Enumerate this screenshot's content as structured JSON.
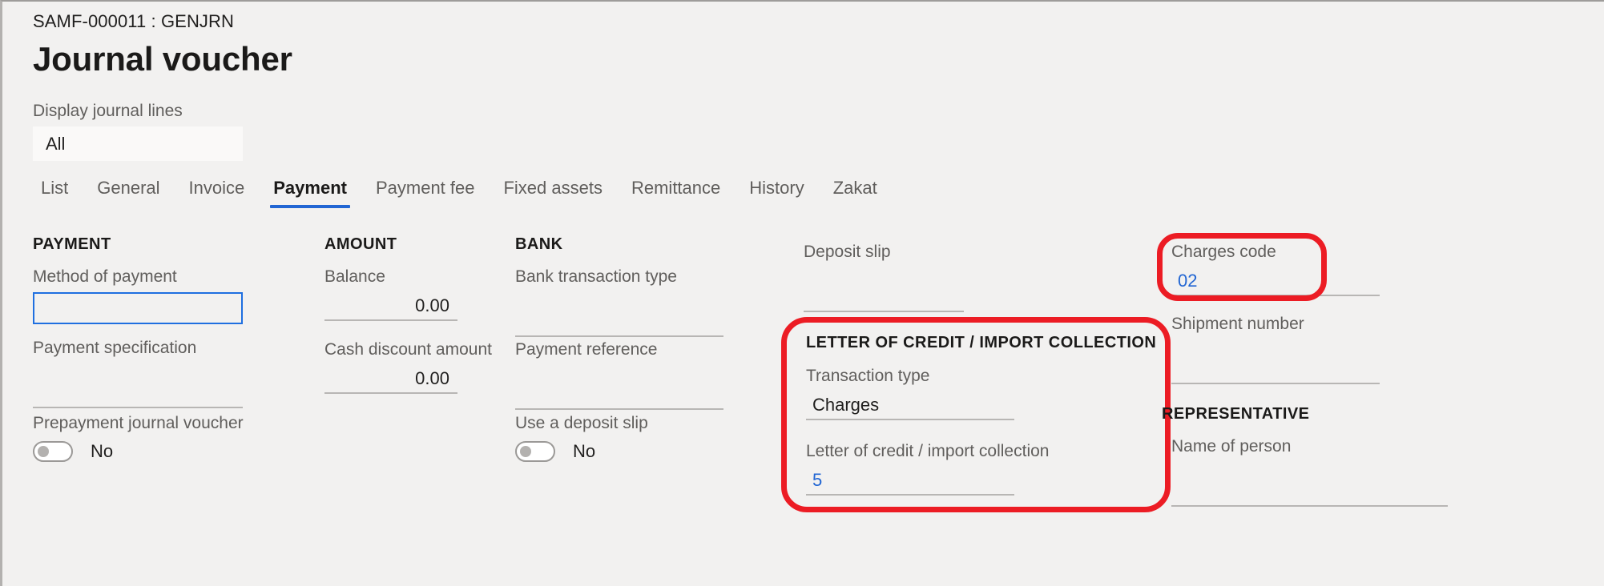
{
  "header": {
    "breadcrumb": "SAMF-000011 : GENJRN",
    "title": "Journal voucher"
  },
  "filter": {
    "label": "Display journal lines",
    "value": "All",
    "options": [
      "All"
    ]
  },
  "tabs": [
    {
      "label": "List",
      "active": false
    },
    {
      "label": "General",
      "active": false
    },
    {
      "label": "Invoice",
      "active": false
    },
    {
      "label": "Payment",
      "active": true
    },
    {
      "label": "Payment fee",
      "active": false
    },
    {
      "label": "Fixed assets",
      "active": false
    },
    {
      "label": "Remittance",
      "active": false
    },
    {
      "label": "History",
      "active": false
    },
    {
      "label": "Zakat",
      "active": false
    }
  ],
  "groups": {
    "payment": {
      "title": "PAYMENT",
      "method_of_payment": {
        "label": "Method of payment",
        "value": ""
      },
      "payment_specification": {
        "label": "Payment specification",
        "value": ""
      },
      "prepayment_journal_voucher": {
        "label": "Prepayment journal voucher",
        "value": "No"
      }
    },
    "amount": {
      "title": "AMOUNT",
      "balance": {
        "label": "Balance",
        "value": "0.00"
      },
      "cash_discount_amount": {
        "label": "Cash discount amount",
        "value": "0.00"
      }
    },
    "bank": {
      "title": "BANK",
      "bank_transaction_type": {
        "label": "Bank transaction type",
        "value": ""
      },
      "payment_reference": {
        "label": "Payment reference",
        "value": ""
      },
      "use_a_deposit_slip": {
        "label": "Use a deposit slip",
        "value": "No"
      },
      "deposit_slip": {
        "label": "Deposit slip",
        "value": ""
      }
    },
    "letter_of_credit": {
      "title": "LETTER OF CREDIT / IMPORT COLLECTION",
      "transaction_type": {
        "label": "Transaction type",
        "value": "Charges"
      },
      "letter_of_credit_import_collection": {
        "label": "Letter of credit / import collection",
        "value": "5"
      }
    },
    "right": {
      "charges_code": {
        "label": "Charges code",
        "value": "02"
      },
      "shipment_number": {
        "label": "Shipment number",
        "value": ""
      }
    },
    "representative": {
      "title": "REPRESENTATIVE",
      "name_of_person": {
        "label": "Name of person",
        "value": ""
      }
    }
  },
  "annotations": {
    "charges_code_highlight": "charges-code-highlight",
    "letter_of_credit_highlight": "letter-of-credit-highlight"
  },
  "colors": {
    "accent_blue": "#2266d3",
    "annotation_red": "#ec1c24",
    "page_background": "#f2f1f0",
    "label_gray": "#605e5c"
  }
}
